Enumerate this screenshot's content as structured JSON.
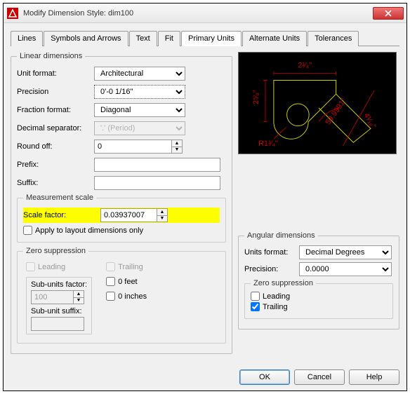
{
  "window": {
    "title": "Modify Dimension Style: dim100"
  },
  "tabs": [
    "Lines",
    "Symbols and Arrows",
    "Text",
    "Fit",
    "Primary Units",
    "Alternate Units",
    "Tolerances"
  ],
  "linear": {
    "legend": "Linear dimensions",
    "unit_format_label": "Unit format:",
    "unit_format": "Architectural",
    "precision_label": "Precision",
    "precision": "0'-0 1/16\"",
    "fraction_format_label": "Fraction format:",
    "fraction_format": "Diagonal",
    "decimal_sep_label": "Decimal separator:",
    "decimal_sep": "'.' (Period)",
    "round_off_label": "Round off:",
    "round_off": "0",
    "prefix_label": "Prefix:",
    "prefix": "",
    "suffix_label": "Suffix:",
    "suffix": ""
  },
  "measurement": {
    "legend": "Measurement scale",
    "scale_factor_label": "Scale factor:",
    "scale_factor": "0.03937007",
    "apply_layout": "Apply to layout dimensions only"
  },
  "zero_sup": {
    "legend": "Zero suppression",
    "leading": "Leading",
    "trailing": "Trailing",
    "feet": "0 feet",
    "inches": "0 inches",
    "sub_factor_label": "Sub-units factor:",
    "sub_factor": "100",
    "sub_suffix_label": "Sub-unit suffix:",
    "sub_suffix": ""
  },
  "angular": {
    "legend": "Angular dimensions",
    "units_format_label": "Units format:",
    "units_format": "Decimal Degrees",
    "precision_label": "Precision:",
    "precision": "0.0000",
    "zero_legend": "Zero suppression",
    "leading": "Leading",
    "trailing": "Trailing"
  },
  "preview": {
    "dim_top": "2¹⁄₄\"",
    "dim_left": "2⁵⁄₈\"",
    "dim_right": "4¹⁄₁₆\"",
    "dim_angle": "59.9991°",
    "dim_radius": "R1³⁄₄\""
  },
  "buttons": {
    "ok": "OK",
    "cancel": "Cancel",
    "help": "Help"
  }
}
